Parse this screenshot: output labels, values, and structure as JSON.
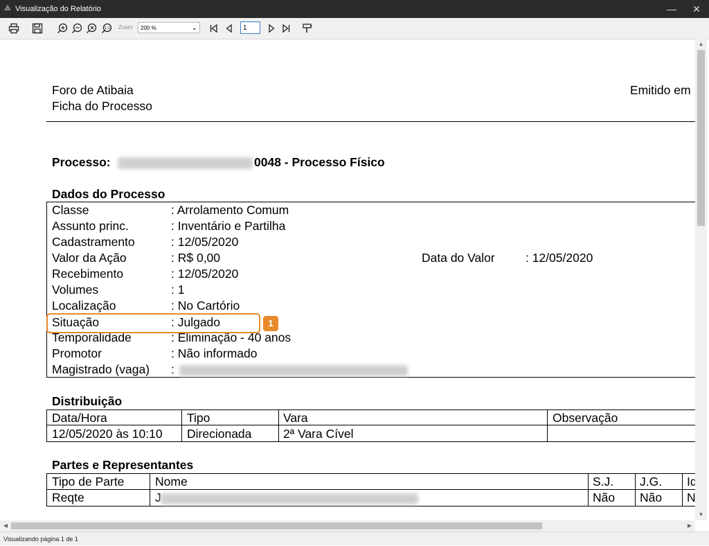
{
  "window": {
    "title": "Visualização do Relatório"
  },
  "toolbar": {
    "zoom_label": "Zoom",
    "zoom_value": "200 %",
    "page_value": "1"
  },
  "header": {
    "forum": "Foro de Atibaia",
    "subtitle": "Ficha do Processo",
    "issued": "Emitido em"
  },
  "processo": {
    "label": "Processo:",
    "suffix": "0048 - Processo Físico"
  },
  "dados": {
    "title": "Dados do Processo",
    "rows": [
      {
        "label": "Classe",
        "value": ": Arrolamento Comum"
      },
      {
        "label": "Assunto princ.",
        "value": ": Inventário e Partilha"
      },
      {
        "label": "Cadastramento",
        "value": ": 12/05/2020"
      },
      {
        "label": "Valor da Ação",
        "value": ": R$ 0,00"
      },
      {
        "label": "Recebimento",
        "value": ": 12/05/2020"
      },
      {
        "label": "Volumes",
        "value": ": 1"
      },
      {
        "label": "Localização",
        "value": ": No Cartório"
      },
      {
        "label": "Situação",
        "value": ": Julgado"
      },
      {
        "label": "Temporalidade",
        "value": ": Eliminação - 40 anos"
      },
      {
        "label": "Promotor",
        "value": ": Não informado"
      },
      {
        "label": "Magistrado (vaga)",
        "value": ":"
      }
    ],
    "data_valor_label": "Data do Valor",
    "data_valor_value": ": 12/05/2020"
  },
  "distribuicao": {
    "title": "Distribuição",
    "headers": [
      "Data/Hora",
      "Tipo",
      "Vara",
      "Observação"
    ],
    "row": [
      "12/05/2020 às 10:10",
      "Direcionada",
      "2ª Vara Cível",
      ""
    ]
  },
  "partes": {
    "title": "Partes e Representantes",
    "headers": [
      "Tipo de Parte",
      "Nome",
      "S.J.",
      "J.G.",
      "Id"
    ],
    "row": [
      "Reqte",
      "J",
      "Não",
      "Não",
      "N"
    ]
  },
  "callout": {
    "number": "1"
  },
  "status": {
    "text": "Visualizando página 1 de 1"
  }
}
